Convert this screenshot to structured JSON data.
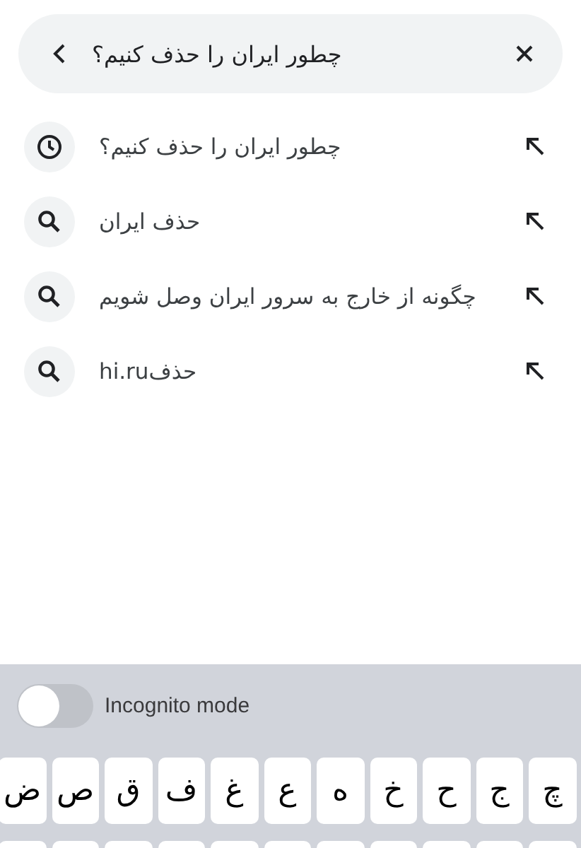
{
  "search": {
    "value": "چطور ایران را حذف کنیم؟"
  },
  "suggestions": [
    {
      "kind": "history",
      "text": "چطور ایران را حذف کنیم؟"
    },
    {
      "kind": "search",
      "text": "حذف ایران"
    },
    {
      "kind": "search",
      "text": "چگونه از خارج به سرور ایران وصل شویم"
    },
    {
      "kind": "search",
      "text": "hi.ruحذف"
    }
  ],
  "incognito": {
    "label": "Incognito mode",
    "on": false
  },
  "keyboard": {
    "keys": [
      "چ",
      "ج",
      "ح",
      "خ",
      "ه",
      "ع",
      "غ",
      "ف",
      "ق",
      "ص",
      "ض"
    ]
  }
}
